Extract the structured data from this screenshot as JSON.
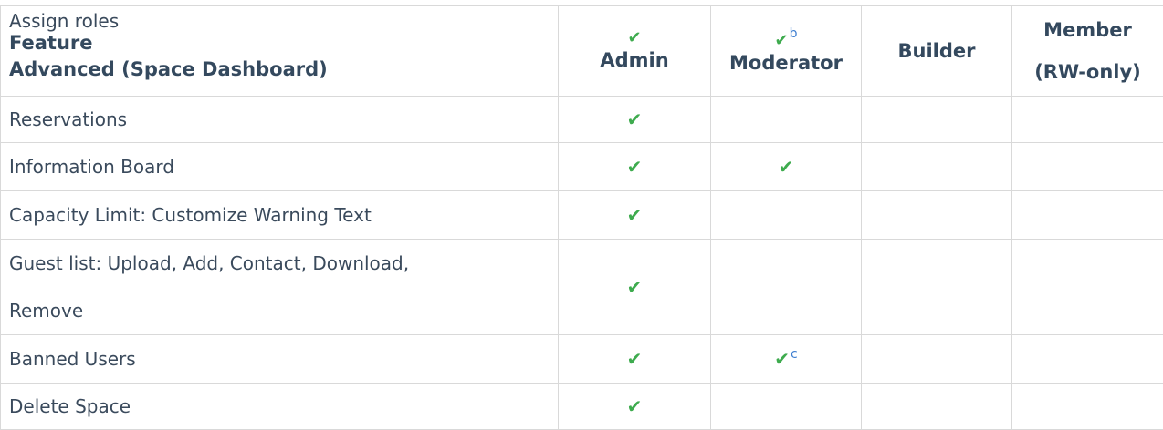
{
  "header": {
    "assign_roles": "Assign roles",
    "feature_label": "Feature",
    "section_title": "Advanced (Space Dashboard)",
    "columns": [
      {
        "label": "Admin",
        "check": "✔",
        "sup": ""
      },
      {
        "label": "Moderator",
        "check": "✔",
        "sup": "b"
      },
      {
        "label": "Builder",
        "check": "",
        "sup": ""
      },
      {
        "label": "Member",
        "label2": "(RW-only)",
        "check": "",
        "sup": ""
      }
    ]
  },
  "rows": [
    {
      "feature": "Reservations",
      "admin": "✔",
      "moderator": "",
      "moderator_sup": "",
      "builder": "",
      "member": ""
    },
    {
      "feature": "Information Board",
      "admin": "✔",
      "moderator": "✔",
      "moderator_sup": "",
      "builder": "",
      "member": ""
    },
    {
      "feature": "Capacity Limit: Customize Warning Text",
      "admin": "✔",
      "moderator": "",
      "moderator_sup": "",
      "builder": "",
      "member": ""
    },
    {
      "feature": "Guest list: Upload, Add, Contact, Download,",
      "feature_line2": "Remove",
      "admin": "✔",
      "moderator": "",
      "moderator_sup": "",
      "builder": "",
      "member": ""
    },
    {
      "feature": "Banned Users",
      "admin": "✔",
      "moderator": "✔",
      "moderator_sup": "c",
      "builder": "",
      "member": ""
    },
    {
      "feature": "Delete Space",
      "admin": "✔",
      "moderator": "",
      "moderator_sup": "",
      "builder": "",
      "member": ""
    }
  ],
  "colors": {
    "check": "#3eab4e",
    "footnote": "#3f7fd0",
    "text": "#2f3e4e",
    "border": "#d9d9d9"
  }
}
